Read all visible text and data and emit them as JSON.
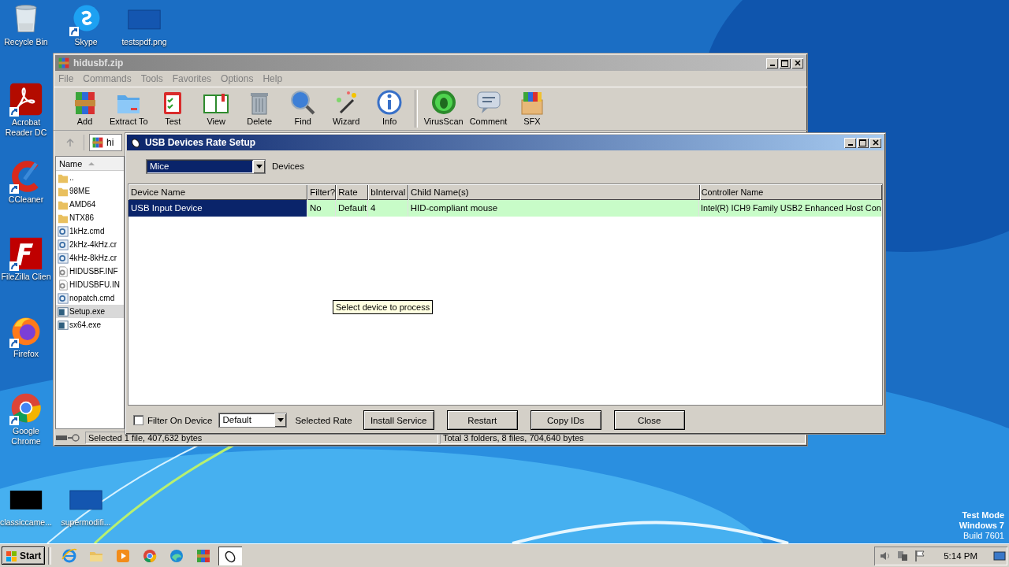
{
  "desktop": {
    "icons": [
      {
        "label": "Recycle Bin",
        "kind": "recycle",
        "shortcut": false
      },
      {
        "label": "Skype",
        "kind": "skype",
        "shortcut": true
      },
      {
        "label": "testspdf.png",
        "kind": "blank",
        "shortcut": false
      },
      {
        "label": "Acrobat Reader DC",
        "kind": "acrobat",
        "shortcut": true
      },
      {
        "label": "CCleaner",
        "kind": "ccleaner",
        "shortcut": true
      },
      {
        "label": "FileZilla Clien",
        "kind": "filezilla",
        "shortcut": true
      },
      {
        "label": "Firefox",
        "kind": "firefox",
        "shortcut": true
      },
      {
        "label": "Google Chrome",
        "kind": "chrome",
        "shortcut": true
      },
      {
        "label": "classiccame...",
        "kind": "black",
        "shortcut": false
      },
      {
        "label": "supermodifi...",
        "kind": "blank",
        "shortcut": false
      }
    ],
    "system_info": [
      "Test Mode",
      "Windows 7",
      "Build 7601"
    ]
  },
  "archiver": {
    "title": "hidusbf.zip",
    "menu": [
      "File",
      "Commands",
      "Tools",
      "Favorites",
      "Options",
      "Help"
    ],
    "toolbar": [
      {
        "label": "Add",
        "kind": "add"
      },
      {
        "label": "Extract To",
        "kind": "extract"
      },
      {
        "label": "Test",
        "kind": "test"
      },
      {
        "label": "View",
        "kind": "view"
      },
      {
        "label": "Delete",
        "kind": "delete"
      },
      {
        "label": "Find",
        "kind": "find"
      },
      {
        "label": "Wizard",
        "kind": "wizard"
      },
      {
        "label": "Info",
        "kind": "info"
      },
      {
        "label": "VirusScan",
        "kind": "virus"
      },
      {
        "label": "Comment",
        "kind": "comment"
      },
      {
        "label": "SFX",
        "kind": "sfx"
      }
    ],
    "address": "hi",
    "column": "Name",
    "files": [
      {
        "name": "..",
        "kind": "folder",
        "selected": false
      },
      {
        "name": "98ME",
        "kind": "folder",
        "selected": false
      },
      {
        "name": "AMD64",
        "kind": "folder",
        "selected": false
      },
      {
        "name": "NTX86",
        "kind": "folder",
        "selected": false
      },
      {
        "name": "1kHz.cmd",
        "kind": "script",
        "selected": false
      },
      {
        "name": "2kHz-4kHz.cr",
        "kind": "script",
        "selected": false
      },
      {
        "name": "4kHz-8kHz.cr",
        "kind": "script",
        "selected": false
      },
      {
        "name": "HIDUSBF.INF",
        "kind": "settings",
        "selected": false
      },
      {
        "name": "HIDUSBFU.IN",
        "kind": "settings",
        "selected": false
      },
      {
        "name": "nopatch.cmd",
        "kind": "script",
        "selected": false
      },
      {
        "name": "Setup.exe",
        "kind": "program",
        "selected": true
      },
      {
        "name": "sx64.exe",
        "kind": "program",
        "selected": false
      }
    ],
    "status": [
      "Selected 1 file, 407,632 bytes",
      "Total 3 folders, 8 files, 704,640 bytes"
    ]
  },
  "dialog": {
    "title": "USB Devices Rate Setup",
    "device_type": "Mice",
    "device_type_label": "Devices",
    "columns": [
      "Device Name",
      "Filter?",
      "Rate",
      "bInterval",
      "Child Name(s)",
      "Controller Name"
    ],
    "rows": [
      {
        "cells": [
          "USB Input Device",
          "No",
          "Default",
          "4",
          "HID-compliant mouse",
          "Intel(R) ICH9 Family USB2 Enhanced Host Con"
        ],
        "selected": true
      }
    ],
    "tooltip": "Select device to process",
    "filter_on_device": {
      "label": "Filter On Device",
      "checked": false
    },
    "rate": "Default",
    "rate_label": "Selected Rate",
    "buttons": [
      "Install Service",
      "Restart",
      "Copy IDs",
      "Close"
    ]
  },
  "taskbar": {
    "start": "Start",
    "apps": [
      {
        "kind": "ie",
        "active": false
      },
      {
        "kind": "explorer",
        "active": false
      },
      {
        "kind": "media",
        "active": false
      },
      {
        "kind": "chrome",
        "active": false
      },
      {
        "kind": "edge",
        "active": false
      },
      {
        "kind": "archiver",
        "active": false
      },
      {
        "kind": "mouse",
        "active": true
      }
    ],
    "clock": "5:14 PM"
  }
}
